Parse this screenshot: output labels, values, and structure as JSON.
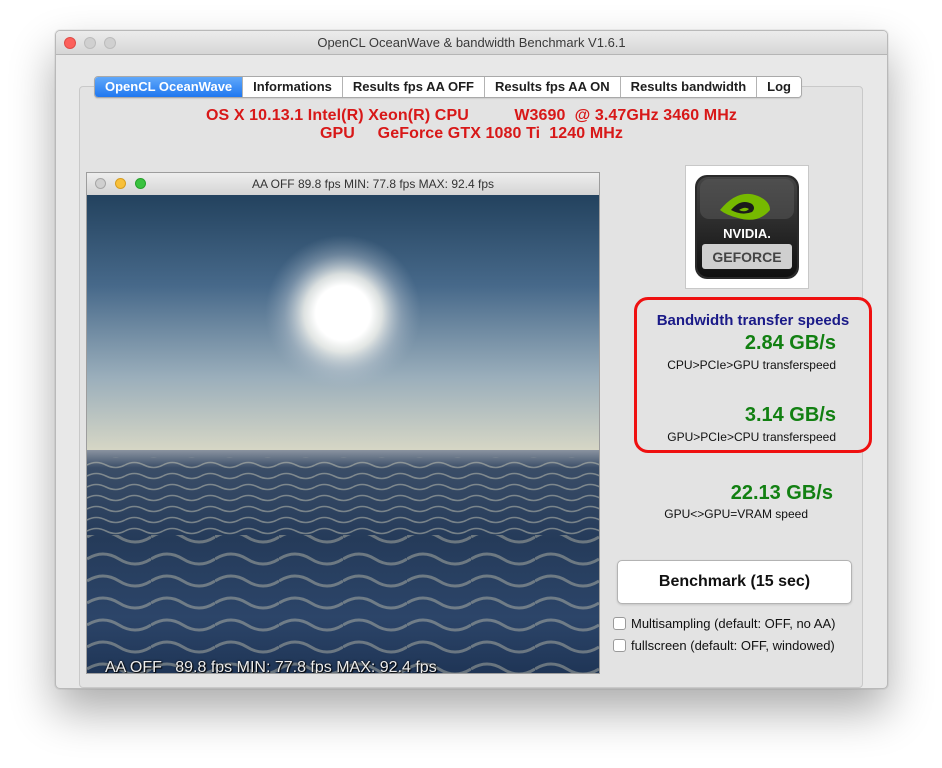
{
  "window": {
    "title": "OpenCL OceanWave & bandwidth Benchmark V1.6.1"
  },
  "tabs": [
    {
      "label": "OpenCL OceanWave",
      "active": true
    },
    {
      "label": "Informations",
      "active": false
    },
    {
      "label": "Results fps AA OFF",
      "active": false
    },
    {
      "label": "Results fps AA ON",
      "active": false
    },
    {
      "label": "Results bandwidth",
      "active": false
    },
    {
      "label": "Log",
      "active": false
    }
  ],
  "system": {
    "cpu_line": "OS X 10.13.1 Intel(R) Xeon(R) CPU          W3690  @ 3.47GHz 3460 MHz",
    "gpu_line": "GPU     GeForce GTX 1080 Ti  1240 MHz"
  },
  "gl_window": {
    "title": "AA OFF   89.8 fps MIN: 77.8 fps MAX: 92.4 fps",
    "overlay": "AA OFF   89.8 fps MIN: 77.8 fps MAX: 92.4 fps"
  },
  "logo": {
    "icon": "nvidia-geforce-logo",
    "brand_text": "NVIDIA.",
    "product_text": "GEFORCE"
  },
  "bandwidth": {
    "title": "Bandwidth transfer speeds",
    "cpu_to_gpu_value": "2.84 GB/s",
    "cpu_to_gpu_label": "CPU>PCIe>GPU transferspeed",
    "gpu_to_cpu_value": "3.14 GB/s",
    "gpu_to_cpu_label": "GPU>PCIe>CPU transferspeed",
    "vram_value": "22.13 GB/s",
    "vram_label": "GPU<>GPU=VRAM speed"
  },
  "controls": {
    "benchmark_button": "Benchmark  (15 sec)",
    "multisampling_label": "Multisampling (default: OFF, no AA)",
    "multisampling_checked": false,
    "fullscreen_label": "fullscreen (default: OFF, windowed)",
    "fullscreen_checked": false
  },
  "colors": {
    "accent_tab": "#1f77f0",
    "cpu_text": "#d81818",
    "speed_value": "#128012",
    "bandwidth_title": "#1a1a88",
    "highlight_border": "#ef1010",
    "traffic_close": "#fc605b"
  }
}
